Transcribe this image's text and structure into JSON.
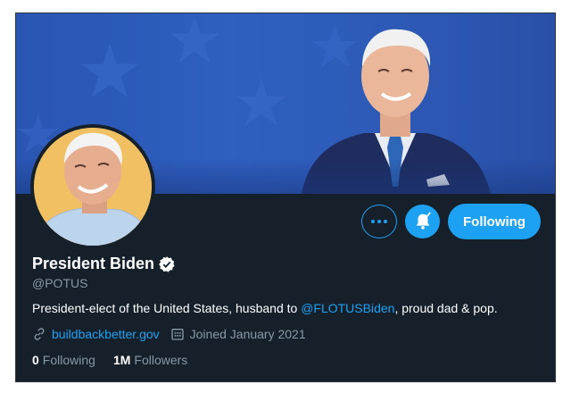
{
  "profile": {
    "display_name": "President Biden",
    "handle": "@POTUS",
    "bio_before": "President-elect of the United States, husband to ",
    "bio_mention": "@FLOTUSBiden",
    "bio_after": ", proud dad & pop.",
    "website": "buildbackbetter.gov",
    "joined": "Joined January 2021",
    "verified": true
  },
  "stats": {
    "following_count": "0",
    "following_label": "Following",
    "followers_count": "1M",
    "followers_label": "Followers"
  },
  "actions": {
    "follow_button_label": "Following",
    "more_icon": "more-horizontal-icon",
    "notification_icon": "bell-check-icon"
  },
  "icons": {
    "verified": "verified-badge-icon",
    "link": "link-icon",
    "calendar": "calendar-icon"
  },
  "colors": {
    "background": "#15202b",
    "accent": "#1da1f2",
    "text_primary": "#ffffff",
    "text_secondary": "#8899a6",
    "banner_blue": "#2f5fbf",
    "avatar_bg": "#f0c062"
  }
}
